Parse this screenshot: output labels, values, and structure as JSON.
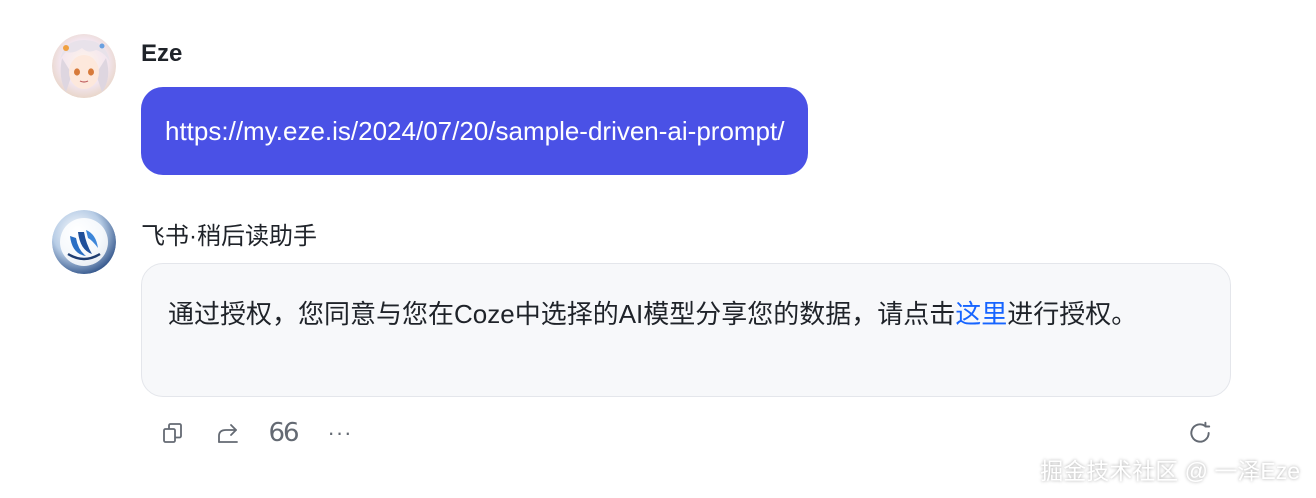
{
  "user_message": {
    "sender": "Eze",
    "text": "https://my.eze.is/2024/07/20/sample-driven-ai-prompt/",
    "bubble_color": "#4a51e6"
  },
  "bot_message": {
    "sender": "飞书·稍后读助手",
    "text_before_link": "通过授权，您同意与您在Coze中选择的AI模型分享您的数据，请点击",
    "link_text": "这里",
    "text_after_link": "进行授权。",
    "link_color": "#1664ff"
  },
  "actions": {
    "copy_icon": "copy-icon",
    "share_icon": "share-icon",
    "quote_icon": "quote-icon",
    "quote_glyph": "66",
    "more_icon": "more-icon",
    "more_glyph": "···",
    "refresh_icon": "refresh-icon"
  },
  "watermark": "掘金技术社区 @ 一泽Eze"
}
